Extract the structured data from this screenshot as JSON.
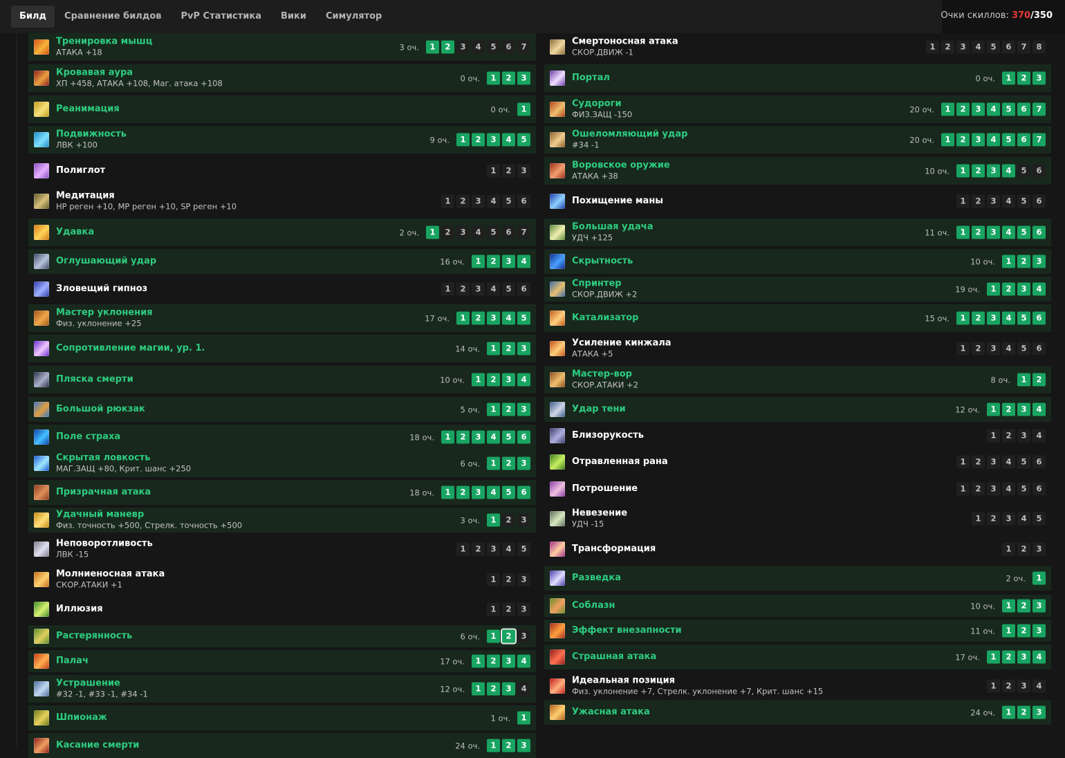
{
  "tabs": [
    {
      "label": "Билд",
      "active": true
    },
    {
      "label": "Сравнение билдов"
    },
    {
      "label": "PvP Статистика"
    },
    {
      "label": "Вики"
    },
    {
      "label": "Симулятор"
    }
  ],
  "points": {
    "label": "Очки скиллов: ",
    "used": "370",
    "separator": "/",
    "max": "350"
  },
  "cost_suffix": " оч.",
  "left_skills": [
    {
      "name": "Тренировка мышц",
      "effect": "АТАКА +18",
      "cost": "3",
      "levels": 7,
      "learned": 2,
      "colors": [
        "#d64d15",
        "#f4b43a"
      ]
    },
    {
      "name": "Кровавая аура",
      "effect": "ХП +458, АТАКА +108, Маг. атака +108",
      "cost": "0",
      "levels": 3,
      "learned": 3,
      "colors": [
        "#8e1a1a",
        "#e8a040"
      ]
    },
    {
      "name": "Реанимация",
      "cost": "0",
      "levels": 1,
      "learned": 1,
      "colors": [
        "#c49a1e",
        "#f5e27a"
      ]
    },
    {
      "name": "Подвижность",
      "effect": "ЛВК +100",
      "cost": "9",
      "levels": 5,
      "learned": 5,
      "colors": [
        "#1a8ac2",
        "#7fe0ff"
      ]
    },
    {
      "name": "Полиглот",
      "levels": 3,
      "learned": 0,
      "colors": [
        "#8a4ec2",
        "#e6b0ff"
      ]
    },
    {
      "name": "Медитация",
      "effect": "HP реген +10, MP реген +10, SP реген +10",
      "levels": 6,
      "learned": 0,
      "colors": [
        "#5f5a2a",
        "#d7c07a"
      ]
    },
    {
      "name": "Удавка",
      "cost": "2",
      "levels": 7,
      "learned": 1,
      "colors": [
        "#d67a12",
        "#ffd35a"
      ]
    },
    {
      "name": "Оглушающий удар",
      "cost": "16",
      "levels": 4,
      "learned": 4,
      "colors": [
        "#3e4a6a",
        "#b8c4d8"
      ]
    },
    {
      "name": "Зловещий гипноз",
      "levels": 6,
      "learned": 0,
      "colors": [
        "#2a3aa8",
        "#9fb0ff"
      ]
    },
    {
      "name": "Мастер уклонения",
      "effect": "Физ. уклонение +25",
      "cost": "17",
      "levels": 5,
      "learned": 5,
      "colors": [
        "#a05418",
        "#f0a84a"
      ]
    },
    {
      "name": "Сопротивление магии, ур. 1.",
      "cost": "14",
      "levels": 3,
      "learned": 3,
      "colors": [
        "#6a2ad0",
        "#f0c8ff"
      ]
    },
    {
      "name": "Пляска смерти",
      "cost": "10",
      "levels": 4,
      "learned": 4,
      "colors": [
        "#2a2f4a",
        "#aab0c8"
      ]
    },
    {
      "name": "Большой рюкзак",
      "cost": "5",
      "levels": 3,
      "learned": 3,
      "colors": [
        "#3a78c8",
        "#e0a040"
      ]
    },
    {
      "name": "Поле страха",
      "cost": "18",
      "levels": 6,
      "learned": 6,
      "colors": [
        "#0d3fa8",
        "#45c0ff"
      ]
    },
    {
      "name": "Скрытая ловкость",
      "effect": "МАГ.ЗАЩ +80, Крит. шанс +250",
      "cost": "6",
      "levels": 3,
      "learned": 3,
      "colors": [
        "#1a5ad0",
        "#9fe8ff"
      ]
    },
    {
      "name": "Призрачная атака",
      "cost": "18",
      "levels": 6,
      "learned": 6,
      "colors": [
        "#8a3a1a",
        "#e0905a"
      ]
    },
    {
      "name": "Удачный маневр",
      "effect": "Физ. точность +500, Стрелк. точность +500",
      "cost": "3",
      "levels": 3,
      "learned": 1,
      "colors": [
        "#c48a12",
        "#ffe07a"
      ]
    },
    {
      "name": "Неповоротливость",
      "effect": "ЛВК -15",
      "levels": 5,
      "learned": 0,
      "colors": [
        "#7a7a8a",
        "#e0e0f0"
      ]
    },
    {
      "name": "Молниеносная атака",
      "effect": "СКОР.АТАКИ +1",
      "levels": 3,
      "learned": 0,
      "colors": [
        "#c46a1a",
        "#ffd070"
      ]
    },
    {
      "name": "Иллюзия",
      "levels": 3,
      "learned": 0,
      "colors": [
        "#3a8a2a",
        "#d8f070"
      ]
    },
    {
      "name": "Растерянность",
      "cost": "6",
      "levels": 3,
      "learned": 2,
      "current": 2,
      "colors": [
        "#5a8a2a",
        "#e0d060"
      ]
    },
    {
      "name": "Палач",
      "cost": "17",
      "levels": 4,
      "learned": 4,
      "colors": [
        "#c43a12",
        "#ffb050"
      ]
    },
    {
      "name": "Устрашение",
      "effect": "#32 -1, #33 -1, #34 -1",
      "cost": "12",
      "levels": 4,
      "learned": 3,
      "colors": [
        "#4a6a9a",
        "#c0d8f0"
      ]
    },
    {
      "name": "Шпионаж",
      "cost": "1",
      "levels": 1,
      "learned": 1,
      "colors": [
        "#6a7a1a",
        "#e8d05a"
      ]
    },
    {
      "name": "Касание смерти",
      "cost": "24",
      "levels": 3,
      "learned": 3,
      "colors": [
        "#8a1a1a",
        "#f0a060"
      ]
    }
  ],
  "right_skills": [
    {
      "name": "Смертоносная атака",
      "effect": "СКОР.ДВИЖ -1",
      "levels": 8,
      "learned": 0,
      "colors": [
        "#8a6a3a",
        "#f0d8a0"
      ]
    },
    {
      "name": "Портал",
      "cost": "0",
      "levels": 3,
      "learned": 3,
      "colors": [
        "#6a3aa8",
        "#f0e0ff"
      ]
    },
    {
      "name": "Судороги",
      "effect": "ФИЗ.ЗАЩ -150",
      "cost": "20",
      "levels": 7,
      "learned": 7,
      "colors": [
        "#b0401a",
        "#f0c070"
      ]
    },
    {
      "name": "Ошеломляющий удар",
      "effect": "#34 -1",
      "cost": "20",
      "levels": 7,
      "learned": 7,
      "colors": [
        "#8a5a2a",
        "#f0d090"
      ]
    },
    {
      "name": "Воровское оружие",
      "effect": "АТАКА +38",
      "cost": "10",
      "levels": 6,
      "learned": 4,
      "colors": [
        "#a02a1a",
        "#f0a070"
      ]
    },
    {
      "name": "Похищение маны",
      "levels": 6,
      "learned": 0,
      "colors": [
        "#1a3aa8",
        "#8fd0ff"
      ]
    },
    {
      "name": "Большая удача",
      "effect": "УДЧ +125",
      "cost": "11",
      "levels": 6,
      "learned": 6,
      "colors": [
        "#5a8a3a",
        "#f0f0b0"
      ]
    },
    {
      "name": "Скрытность",
      "cost": "10",
      "levels": 3,
      "learned": 3,
      "colors": [
        "#0d2a8a",
        "#4aa0ff"
      ]
    },
    {
      "name": "Спринтер",
      "effect": "СКОР.ДВИЖ +2",
      "cost": "19",
      "levels": 4,
      "learned": 4,
      "colors": [
        "#3a6aa8",
        "#e8c070"
      ]
    },
    {
      "name": "Катализатор",
      "cost": "15",
      "levels": 6,
      "learned": 6,
      "colors": [
        "#c05a1a",
        "#ffd080"
      ]
    },
    {
      "name": "Усиление кинжала",
      "effect": "АТАКА +5",
      "levels": 6,
      "learned": 0,
      "colors": [
        "#c0501a",
        "#ffd07a"
      ]
    },
    {
      "name": "Мастер-вор",
      "effect": "СКОР.АТАКИ +2",
      "cost": "8",
      "levels": 2,
      "learned": 2,
      "colors": [
        "#8a4a1a",
        "#f0c070"
      ]
    },
    {
      "name": "Удар тени",
      "cost": "12",
      "levels": 4,
      "learned": 4,
      "colors": [
        "#3a5a8a",
        "#d0d8e8"
      ]
    },
    {
      "name": "Близорукость",
      "levels": 4,
      "learned": 0,
      "colors": [
        "#3a3a6a",
        "#b0b0e0"
      ]
    },
    {
      "name": "Отравленная рана",
      "levels": 6,
      "learned": 0,
      "colors": [
        "#3a7a1a",
        "#c8f060"
      ]
    },
    {
      "name": "Потрошение",
      "levels": 6,
      "learned": 0,
      "colors": [
        "#8a3aa8",
        "#f0c0e0"
      ]
    },
    {
      "name": "Невезение",
      "effect": "УДЧ -15",
      "levels": 5,
      "learned": 0,
      "colors": [
        "#5a6a5a",
        "#d8e8c0"
      ]
    },
    {
      "name": "Трансформация",
      "levels": 3,
      "learned": 0,
      "colors": [
        "#a02a8a",
        "#ffd0a0"
      ]
    },
    {
      "name": "Разведка",
      "cost": "2",
      "levels": 1,
      "learned": 1,
      "colors": [
        "#4a3aa8",
        "#e0e0ff"
      ]
    },
    {
      "name": "Соблазн",
      "cost": "10",
      "levels": 3,
      "learned": 3,
      "colors": [
        "#6a8a2a",
        "#f0a060"
      ]
    },
    {
      "name": "Эффект внезапности",
      "cost": "11",
      "levels": 3,
      "learned": 3,
      "colors": [
        "#a02a1a",
        "#ffa040"
      ]
    },
    {
      "name": "Страшная атака",
      "cost": "17",
      "levels": 4,
      "learned": 4,
      "colors": [
        "#8a1a1a",
        "#ff7050"
      ]
    },
    {
      "name": "Идеальная позиция",
      "effect": "Физ. уклонение +7, Стрелк. уклонение +7, Крит. шанс +15",
      "levels": 4,
      "learned": 0,
      "colors": [
        "#c01a1a",
        "#ffb080"
      ]
    },
    {
      "name": "Ужасная атака",
      "cost": "24",
      "levels": 3,
      "learned": 3,
      "colors": [
        "#b05a1a",
        "#ffd070"
      ]
    }
  ]
}
